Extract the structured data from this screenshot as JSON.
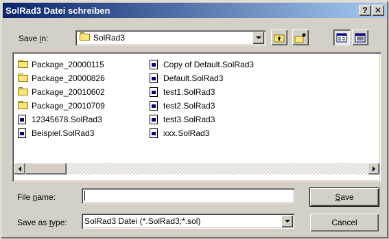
{
  "window": {
    "title": "SolRad3 Datei schreiben",
    "help_label": "?",
    "close_label": "✕"
  },
  "save_in": {
    "label_pre": "Save ",
    "label_key": "i",
    "label_post": "n:",
    "value": "SolRad3"
  },
  "toolbar": {
    "icons": [
      "up-one-level-icon",
      "create-new-folder-icon",
      "list-view-icon",
      "details-view-icon"
    ]
  },
  "files": {
    "column1": [
      {
        "name": "Package_20000115",
        "type": "folder"
      },
      {
        "name": "Package_20000826",
        "type": "folder"
      },
      {
        "name": "Package_20010602",
        "type": "folder"
      },
      {
        "name": "Package_20010709",
        "type": "folder"
      },
      {
        "name": "12345678.SolRad3",
        "type": "file"
      },
      {
        "name": "Beispiel.SolRad3",
        "type": "file"
      }
    ],
    "column2": [
      {
        "name": "Copy of Default.SolRad3",
        "type": "file"
      },
      {
        "name": "Default.SolRad3",
        "type": "file"
      },
      {
        "name": "test1.SolRad3",
        "type": "file"
      },
      {
        "name": "test2.SolRad3",
        "type": "file"
      },
      {
        "name": "test3.SolRad3",
        "type": "file"
      },
      {
        "name": "xxx.SolRad3",
        "type": "file"
      }
    ]
  },
  "file_name": {
    "label_pre": "File ",
    "label_key": "n",
    "label_post": "ame:",
    "value": ""
  },
  "save_as_type": {
    "label_pre": "Save as ",
    "label_key": "t",
    "label_post": "ype:",
    "value": "SolRad3 Datei (*.SolRad3;*.sol)"
  },
  "buttons": {
    "save_key": "S",
    "save_rest": "ave",
    "cancel": "Cancel"
  },
  "colors": {
    "title_start": "#0a246a",
    "title_end": "#a6caf0",
    "face": "#d4d0c8"
  }
}
